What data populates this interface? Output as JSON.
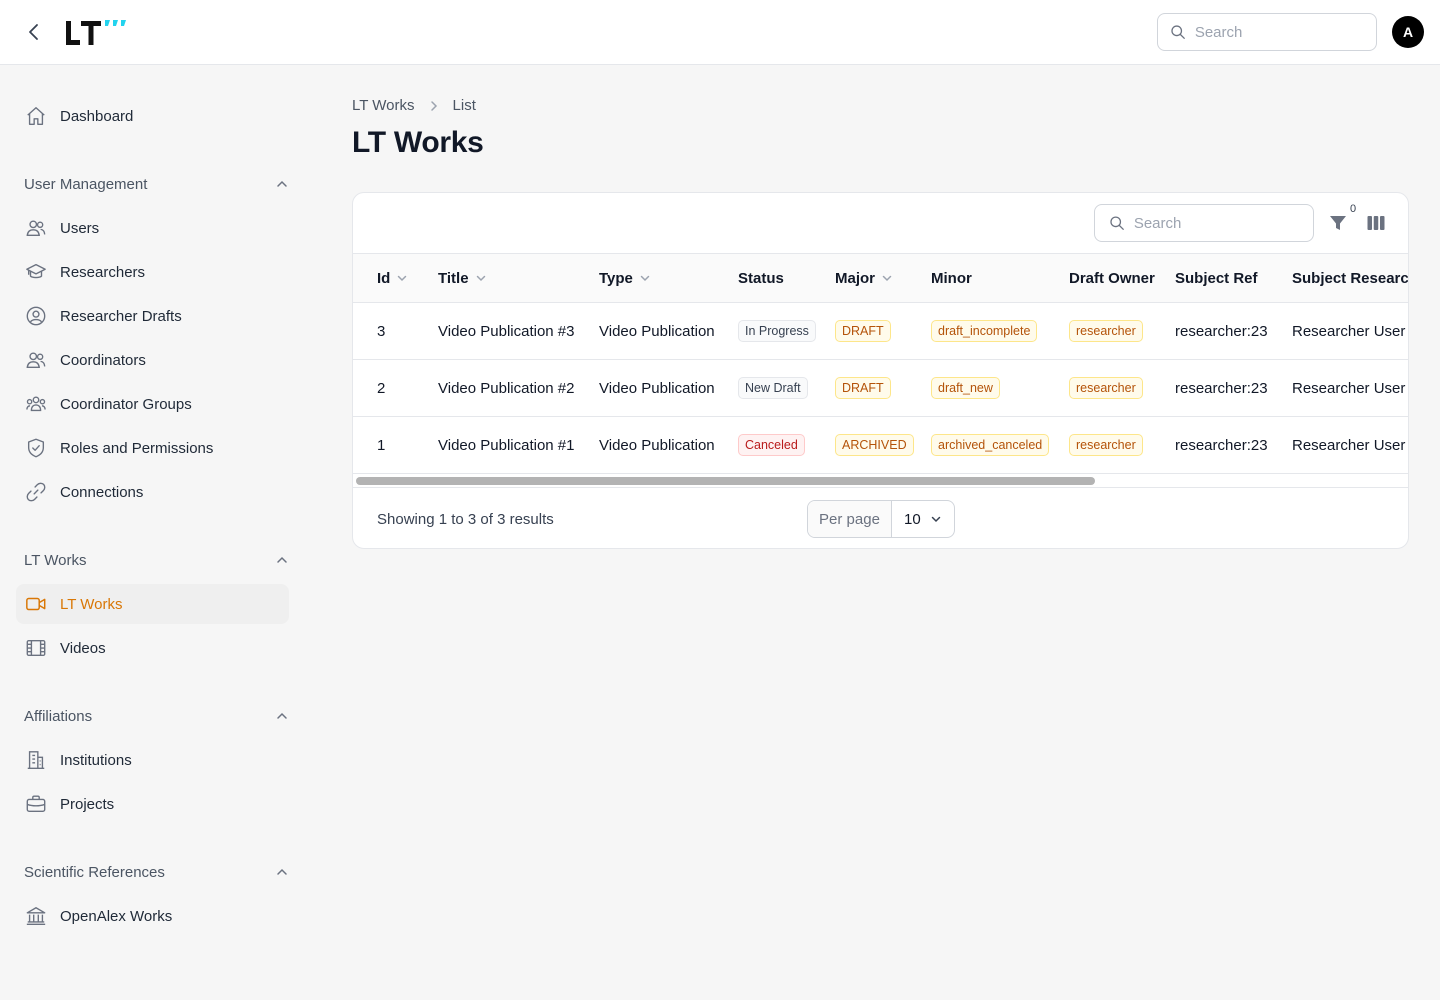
{
  "topbar": {
    "back_icon": "chevron-left-icon",
    "logo_text": "LT",
    "search_placeholder": "Search",
    "avatar_initial": "A"
  },
  "sidebar": {
    "dashboard": {
      "label": "Dashboard",
      "icon": "home-icon"
    },
    "groups": [
      {
        "label": "User Management",
        "items": [
          {
            "label": "Users",
            "icon": "users-icon"
          },
          {
            "label": "Researchers",
            "icon": "academic-cap-icon"
          },
          {
            "label": "Researcher Drafts",
            "icon": "user-circle-icon"
          },
          {
            "label": "Coordinators",
            "icon": "users-icon"
          },
          {
            "label": "Coordinator Groups",
            "icon": "user-group-icon"
          },
          {
            "label": "Roles and Permissions",
            "icon": "shield-check-icon"
          },
          {
            "label": "Connections",
            "icon": "link-icon"
          }
        ]
      },
      {
        "label": "LT Works",
        "items": [
          {
            "label": "LT Works",
            "icon": "video-camera-icon",
            "active": true
          },
          {
            "label": "Videos",
            "icon": "film-icon"
          }
        ]
      },
      {
        "label": "Affiliations",
        "items": [
          {
            "label": "Institutions",
            "icon": "building-icon"
          },
          {
            "label": "Projects",
            "icon": "briefcase-icon"
          }
        ]
      },
      {
        "label": "Scientific References",
        "items": [
          {
            "label": "OpenAlex Works",
            "icon": "library-icon"
          }
        ]
      }
    ],
    "accent_color": "#d97706"
  },
  "breadcrumb": {
    "items": [
      "LT Works",
      "List"
    ]
  },
  "page": {
    "title": "LT Works"
  },
  "table": {
    "search_placeholder": "Search",
    "filter_count": "0",
    "columns": [
      "Id",
      "Title",
      "Type",
      "Status",
      "Major",
      "Minor",
      "Draft Owner",
      "Subject Ref",
      "Subject Research"
    ],
    "rows": [
      {
        "id": "3",
        "title": "Video Publication #3",
        "type": "Video Publication",
        "status": "In Progress",
        "status_color": "gray",
        "major": "DRAFT",
        "minor": "draft_incomplete",
        "owner": "researcher",
        "subject_ref": "researcher:23",
        "subject_research": "Researcher User"
      },
      {
        "id": "2",
        "title": "Video Publication #2",
        "type": "Video Publication",
        "status": "New Draft",
        "status_color": "gray",
        "major": "DRAFT",
        "minor": "draft_new",
        "owner": "researcher",
        "subject_ref": "researcher:23",
        "subject_research": "Researcher User"
      },
      {
        "id": "1",
        "title": "Video Publication #1",
        "type": "Video Publication",
        "status": "Canceled",
        "status_color": "red",
        "major": "ARCHIVED",
        "minor": "archived_canceled",
        "owner": "researcher",
        "subject_ref": "researcher:23",
        "subject_research": "Researcher User"
      }
    ],
    "footer": {
      "summary": "Showing 1 to 3 of 3 results",
      "per_page_label": "Per page",
      "per_page_value": "10"
    }
  }
}
